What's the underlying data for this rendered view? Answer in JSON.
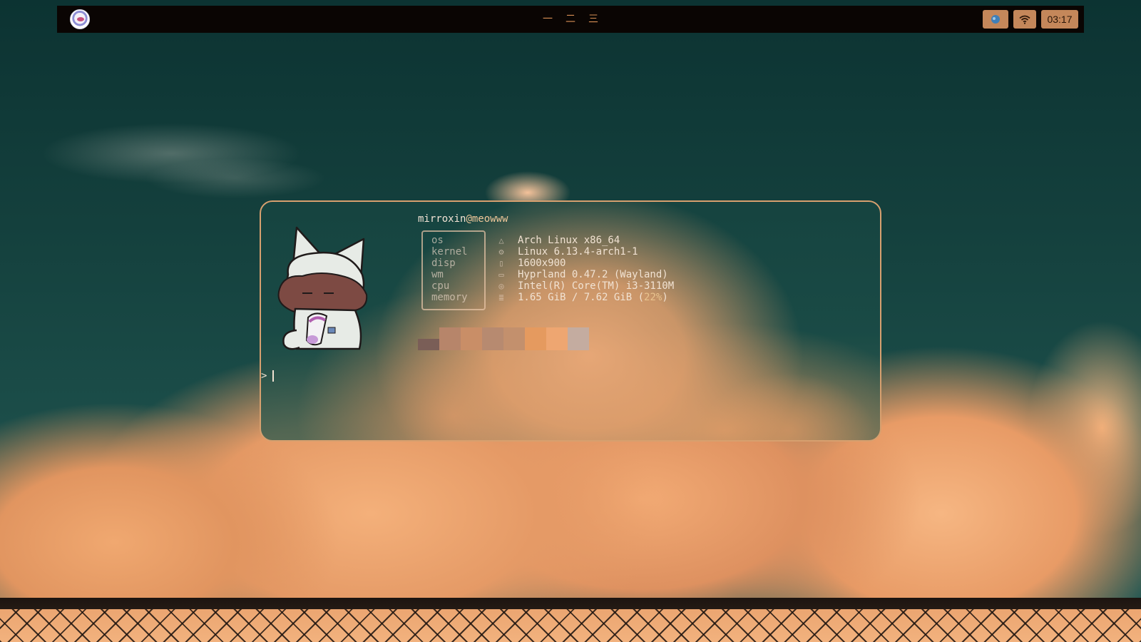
{
  "topbar": {
    "workspaces": [
      "一",
      "二",
      "三"
    ],
    "clock": "03:17",
    "tray_icons": [
      "app-icon",
      "wifi-icon"
    ]
  },
  "terminal": {
    "user": "mirroxin",
    "at": "@",
    "host": "meowww",
    "info": [
      {
        "label": "os",
        "glyph": "△",
        "value": "Arch Linux x86_64"
      },
      {
        "label": "kernel",
        "glyph": "⚙",
        "value": "Linux 6.13.4-arch1-1"
      },
      {
        "label": "disp",
        "glyph": "▯",
        "value": "1600x900"
      },
      {
        "label": "wm",
        "glyph": "▭",
        "value": "Hyprland 0.47.2 (Wayland)"
      },
      {
        "label": "cpu",
        "glyph": "◎",
        "value": "Intel(R) Core(TM) i3-3110M"
      },
      {
        "label": "memory",
        "glyph": "≣",
        "value": "1.65 GiB / 7.62 GiB (",
        "value_pct": "22%",
        "value_end": ")"
      }
    ],
    "palette": [
      "#7a5e57",
      "#b7856a",
      "#c98e67",
      "#b78a70",
      "#c3906d",
      "#e59a5f",
      "#eea671",
      "#c4aca0"
    ],
    "prompt_symbol": ">"
  },
  "colors": {
    "accent": "#d78e54",
    "topbar_bg": "#0a0503",
    "tray_button": "#c4875a"
  }
}
